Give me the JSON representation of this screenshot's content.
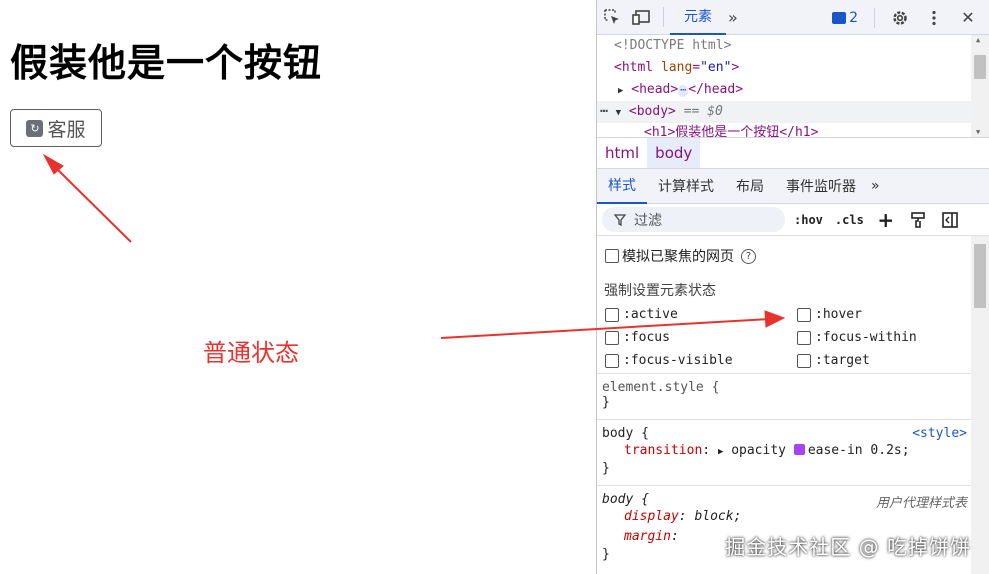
{
  "page": {
    "heading": "假装他是一个按钮",
    "button_label": "客服",
    "annotation": "普通状态"
  },
  "devtools": {
    "toolbar": {
      "inspect_icon": "element-picker-icon",
      "device_icon": "device-toggle-icon",
      "elements_tab": "元素",
      "more": "»",
      "issues_count": "2",
      "settings_icon": "gear-icon",
      "menu_icon": "kebab-icon",
      "close": "✕"
    },
    "dom": {
      "doctype": "<!DOCTYPE html>",
      "html_open_tag": "<html",
      "html_attr": "lang",
      "html_attr_value": "\"en\"",
      "html_close_bracket": ">",
      "head_open": "<head>",
      "head_dots": "⋯",
      "head_close": "</head>",
      "body_dots": "⋯",
      "body_tag": "<body>",
      "body_eq": "== $0",
      "h1_line": "<h1>假装他是一个按钮</h1>"
    },
    "breadcrumbs": [
      "html",
      "body"
    ],
    "subtabs": [
      "样式",
      "计算样式",
      "布局",
      "事件监听器",
      "»"
    ],
    "filter": {
      "placeholder": "过滤",
      "hov": ":hov",
      "cls": ".cls",
      "add": "+"
    },
    "emulate_focus": "模拟已聚焦的网页",
    "force_state_title": "强制设置元素状态",
    "states": [
      ":active",
      ":hover",
      ":focus",
      ":focus-within",
      ":focus-visible",
      ":target"
    ],
    "rules": {
      "element_style": "element.style {",
      "close_brace": "}",
      "body_selector": "body {",
      "body_source": "<style>",
      "transition_name": "transition",
      "transition_value": "opacity",
      "transition_easing": "ease-in 0.2s;",
      "ua_selector": "body {",
      "ua_source": "用户代理样式表",
      "display_name": "display",
      "display_value": "block;",
      "margin_name": "margin"
    }
  },
  "watermark": "掘金技术社区 @ 吃掉饼饼",
  "colors": {
    "annotation_red": "#e8322e",
    "devtools_accent": "#1a56c8",
    "tag_purple": "#881280"
  }
}
